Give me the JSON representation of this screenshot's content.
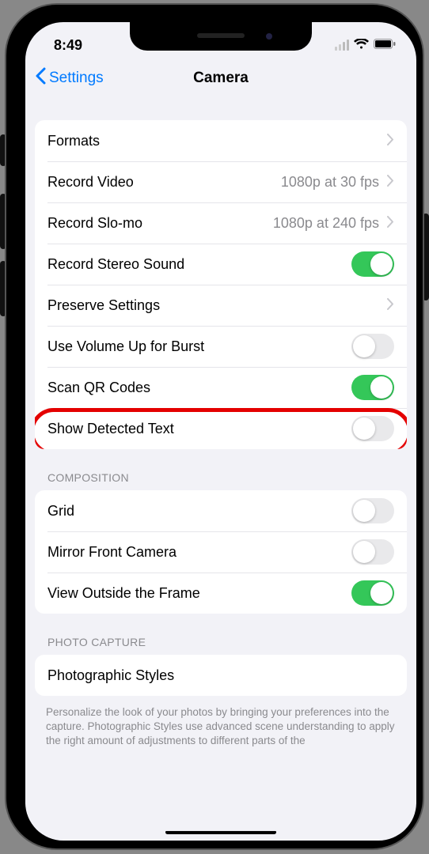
{
  "status": {
    "time": "8:49"
  },
  "nav": {
    "back": "Settings",
    "title": "Camera"
  },
  "group1": {
    "rows": [
      {
        "label": "Formats",
        "type": "disclosure"
      },
      {
        "label": "Record Video",
        "detail": "1080p at 30 fps",
        "type": "disclosure"
      },
      {
        "label": "Record Slo-mo",
        "detail": "1080p at 240 fps",
        "type": "disclosure"
      },
      {
        "label": "Record Stereo Sound",
        "type": "toggle",
        "on": true
      },
      {
        "label": "Preserve Settings",
        "type": "disclosure"
      },
      {
        "label": "Use Volume Up for Burst",
        "type": "toggle",
        "on": false
      },
      {
        "label": "Scan QR Codes",
        "type": "toggle",
        "on": true
      },
      {
        "label": "Show Detected Text",
        "type": "toggle",
        "on": false,
        "highlight": true
      }
    ]
  },
  "group2": {
    "header": "COMPOSITION",
    "rows": [
      {
        "label": "Grid",
        "type": "toggle",
        "on": false
      },
      {
        "label": "Mirror Front Camera",
        "type": "toggle",
        "on": false
      },
      {
        "label": "View Outside the Frame",
        "type": "toggle",
        "on": true
      }
    ]
  },
  "group3": {
    "header": "PHOTO CAPTURE",
    "rows": [
      {
        "label": "Photographic Styles",
        "type": "link"
      }
    ],
    "footer": "Personalize the look of your photos by bringing your preferences into the capture. Photographic Styles use advanced scene understanding to apply the right amount of adjustments to different parts of the"
  }
}
